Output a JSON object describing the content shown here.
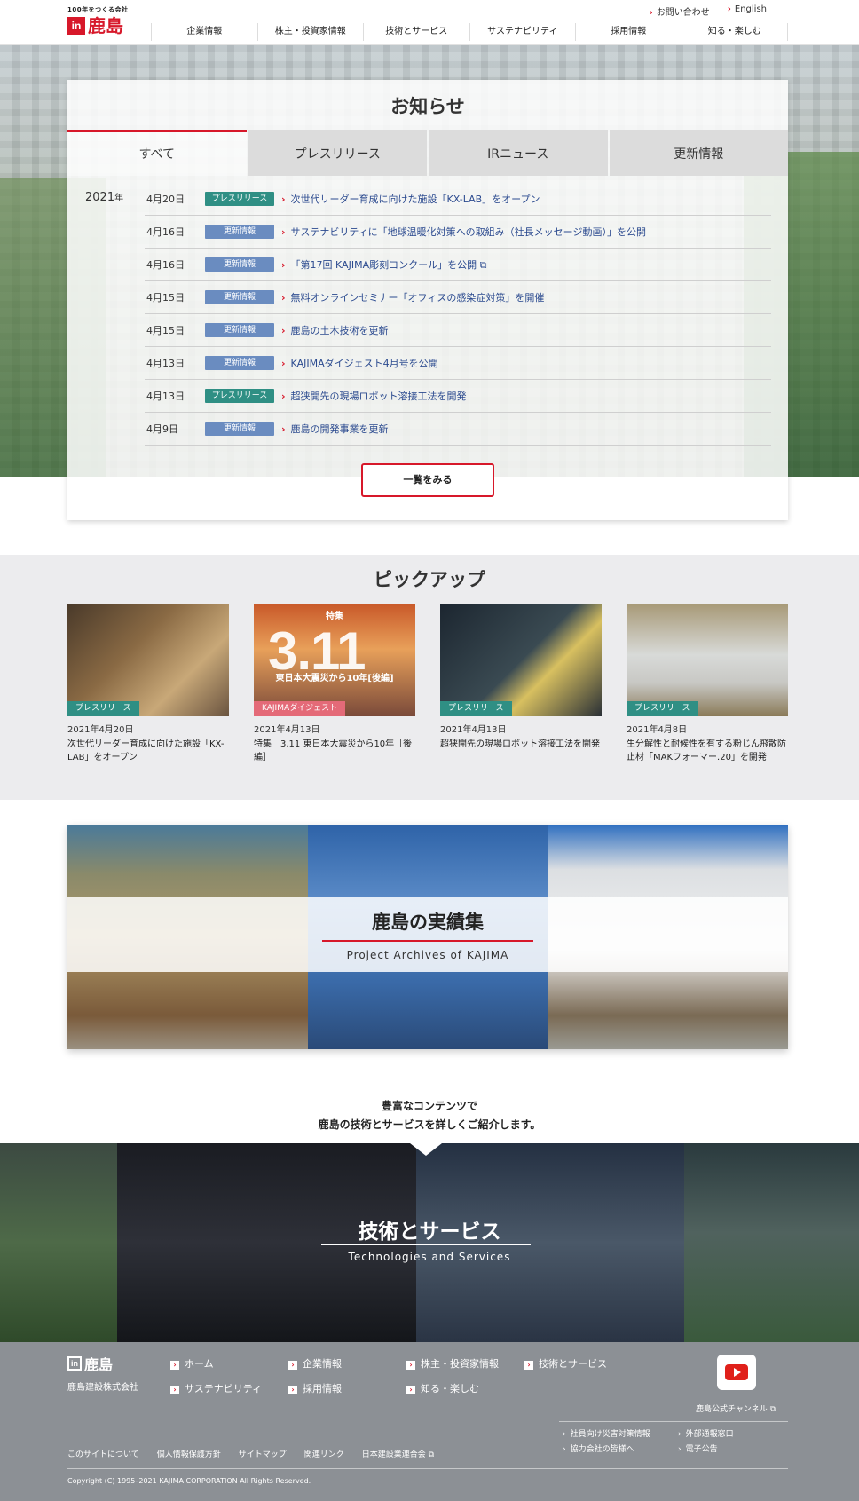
{
  "header": {
    "tagline": "100年をつくる会社",
    "logo_mark": "in",
    "logo_name": "鹿島",
    "util": [
      {
        "label": "お問い合わせ"
      },
      {
        "label": "English"
      }
    ],
    "nav": [
      "企業情報",
      "株主・投資家情報",
      "技術とサービス",
      "サステナビリティ",
      "採用情報",
      "知る・楽しむ"
    ]
  },
  "news": {
    "title": "お知らせ",
    "tabs": [
      "すべて",
      "プレスリリース",
      "IRニュース",
      "更新情報"
    ],
    "active_tab": 0,
    "year": "2021",
    "year_unit": "年",
    "items": [
      {
        "date": "4月20日",
        "type": "press",
        "badge": "プレスリリース",
        "title": "次世代リーダー育成に向けた施設「KX-LAB」をオープン"
      },
      {
        "date": "4月16日",
        "type": "update",
        "badge": "更新情報",
        "title": "サステナビリティに「地球温暖化対策への取組み（社長メッセージ動画）」を公開"
      },
      {
        "date": "4月16日",
        "type": "update",
        "badge": "更新情報",
        "title": "「第17回 KAJIMA彫刻コンクール」を公開 ⧉"
      },
      {
        "date": "4月15日",
        "type": "update",
        "badge": "更新情報",
        "title": "無料オンラインセミナー「オフィスの感染症対策」を開催"
      },
      {
        "date": "4月15日",
        "type": "update",
        "badge": "更新情報",
        "title": "鹿島の土木技術を更新"
      },
      {
        "date": "4月13日",
        "type": "update",
        "badge": "更新情報",
        "title": "KAJIMAダイジェスト4月号を公開"
      },
      {
        "date": "4月13日",
        "type": "press",
        "badge": "プレスリリース",
        "title": "超狭開先の現場ロボット溶接工法を開発"
      },
      {
        "date": "4月9日",
        "type": "update",
        "badge": "更新情報",
        "title": "鹿島の開発事業を更新"
      }
    ],
    "more_label": "一覧をみる"
  },
  "pickup": {
    "title": "ピックアップ",
    "cards": [
      {
        "category": "プレスリリース",
        "cat_type": "press",
        "date": "2021年4月20日",
        "title": "次世代リーダー育成に向けた施設「KX-LAB」をオープン"
      },
      {
        "category": "KAJIMAダイジェスト",
        "cat_type": "digest",
        "date": "2021年4月13日",
        "title": "特集　3.11 東日本大震災から10年［後編］",
        "thumb_small": "特集",
        "thumb_big": "3.11",
        "thumb_sub": "東日本大震災から10年[後編]"
      },
      {
        "category": "プレスリリース",
        "cat_type": "press",
        "date": "2021年4月13日",
        "title": "超狭開先の現場ロボット溶接工法を開発"
      },
      {
        "category": "プレスリリース",
        "cat_type": "press",
        "date": "2021年4月8日",
        "title": "生分解性と耐候性を有する粉じん飛散防止材「MAKフォーマー.20」を開発"
      }
    ]
  },
  "archives": {
    "title": "鹿島の実績集",
    "subtitle": "Project Archives of KAJIMA"
  },
  "intro": {
    "line1": "豊富なコンテンツで",
    "line2": "鹿島の技術とサービスを詳しくご紹介します。"
  },
  "tech": {
    "title": "技術とサービス",
    "subtitle": "Technologies and Services"
  },
  "footer": {
    "logo_mark": "in",
    "logo_name": "鹿島",
    "corp": "鹿島建設株式会社",
    "links": [
      "ホーム",
      "企業情報",
      "株主・投資家情報",
      "技術とサービス",
      "サステナビリティ",
      "採用情報",
      "知る・楽しむ"
    ],
    "youtube_label": "鹿島公式チャンネル ⧉",
    "sub_links": [
      "社員向け災害対策情報",
      "外部通報窓口",
      "協力会社の皆様へ",
      "電子公告"
    ],
    "bottom_links": [
      "このサイトについて",
      "個人情報保護方針",
      "サイトマップ",
      "関連リンク",
      "日本建設業連合会 ⧉"
    ],
    "copyright": "Copyright (C) 1995–2021 KAJIMA CORPORATION All Rights Reserved."
  },
  "colors": {
    "brand_red": "#d7182a",
    "press_badge": "#2f8f84",
    "update_badge": "#6a8cc0",
    "digest_badge": "#e46a78",
    "link_blue": "#2b4a8f",
    "footer_bg": "#8c9095"
  }
}
